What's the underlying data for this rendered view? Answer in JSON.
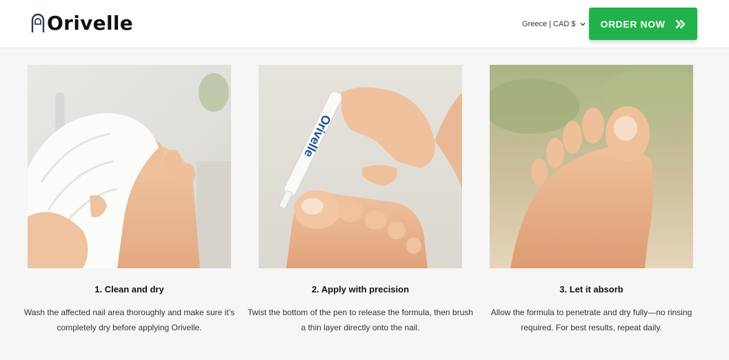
{
  "brand": {
    "name": "Orivelle"
  },
  "header": {
    "locale_label": "Greece | CAD $",
    "order_button_label": "ORDER NOW"
  },
  "colors": {
    "accent": "#22b24c",
    "background": "#f6f6f6"
  },
  "steps": [
    {
      "title": "1. Clean and dry",
      "description": "Wash the affected nail area thoroughly and make sure it’s completely dry before applying Orivelle.",
      "image_name": "towel-drying-foot-photo"
    },
    {
      "title": "2. Apply with precision",
      "description": "Twist the bottom of the pen to release the formula, then brush a thin layer directly onto the nail.",
      "image_name": "pen-applying-to-toenail-photo",
      "pen_label": "Orivelle"
    },
    {
      "title": "3. Let it absorb",
      "description": "Allow the formula to penetrate and dry fully—no rinsing required. For best results, repeat daily.",
      "image_name": "bare-foot-outdoors-photo"
    }
  ]
}
